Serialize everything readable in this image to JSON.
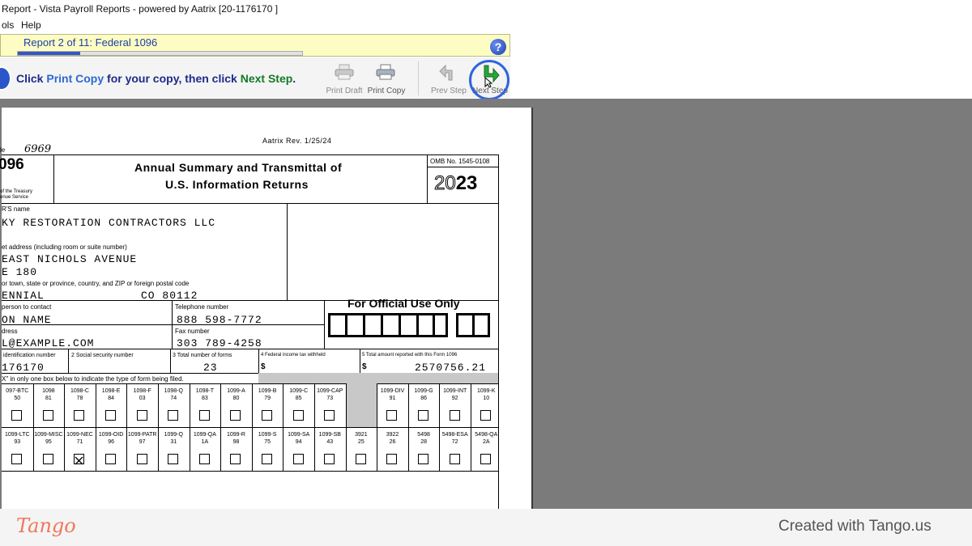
{
  "window": {
    "title": "Report - Vista Payroll Reports - powered by Aatrix [20-1176170 ]"
  },
  "menu": {
    "items": [
      "ols",
      "Help"
    ]
  },
  "report": {
    "title": "Report 2 of 11: Federal 1096",
    "progress": 0.22
  },
  "toolbar": {
    "instr_prefix": "Click ",
    "instr_print_copy": "Print Copy",
    "instr_middle": " for your copy, then click ",
    "instr_next_step": "Next Step",
    "instr_suffix": ".",
    "print_draft": "Print Draft",
    "print_copy": "Print Copy",
    "prev_step": "Prev Step",
    "next_step": "Next Step"
  },
  "form": {
    "rev": "Aatrix Rev. 1/25/24",
    "code_label": "le",
    "code_value": "6969",
    "form_number": "096",
    "dept_line1": "of the Treasury",
    "dept_line2": "enue Service",
    "title1": "Annual Summary and Transmittal of",
    "title2": "U.S. Information Returns",
    "omb": "OMB No. 1545-0108",
    "year_light": "20",
    "year_bold": "23",
    "filer_name_label": "R'S name",
    "filer_name": "KY RESTORATION CONTRACTORS LLC",
    "street_label": "et address (including room or suite number)",
    "street1": " EAST NICHOLS AVENUE",
    "street2": "E 180",
    "city_label": "or town, state or province, country, and ZIP or foreign postal code",
    "city": "ENNIAL",
    "state_zip": "CO 80112",
    "contact_label": "person to contact",
    "contact": "ON NAME",
    "phone_label": "Telephone number",
    "phone": "888 598-7772",
    "email_label": "dress",
    "email": "L@EXAMPLE.COM",
    "fax_label": "Fax number",
    "fax": "303 789-4258",
    "official_use": "For Official Use Only",
    "box1_label": "identification number",
    "box1_value": "176170",
    "box2_label": "2  Social security number",
    "box3_label": "3 Total number of forms",
    "box3_value": "23",
    "box4_label": "4   Federal income tax withheld",
    "box4_value": "$",
    "box5_label": "5  Total amount reported with this Form 1096",
    "box5_dollar": "$",
    "box5_value": "2570756.21",
    "box6_label": "X\" in only one box below to indicate the type of form being filed.",
    "row1": [
      {
        "name": "097-BTC",
        "code": "50",
        "checked": false
      },
      {
        "name": "1098",
        "code": "81",
        "checked": false
      },
      {
        "name": "1098-C",
        "code": "78",
        "checked": false
      },
      {
        "name": "1098-E",
        "code": "84",
        "checked": false
      },
      {
        "name": "1098-F",
        "code": "03",
        "checked": false
      },
      {
        "name": "1098-Q",
        "code": "74",
        "checked": false
      },
      {
        "name": "1098-T",
        "code": "83",
        "checked": false
      },
      {
        "name": "1099-A",
        "code": "80",
        "checked": false
      },
      {
        "name": "1099-B",
        "code": "79",
        "checked": false
      },
      {
        "name": "1099-C",
        "code": "85",
        "checked": false
      },
      {
        "name": "1099-CAP",
        "code": "73",
        "checked": false
      },
      {
        "name": "",
        "code": "",
        "checked": false
      },
      {
        "name": "1099-DIV",
        "code": "91",
        "checked": false
      },
      {
        "name": "1099-G",
        "code": "86",
        "checked": false
      },
      {
        "name": "1099-INT",
        "code": "92",
        "checked": false
      },
      {
        "name": "1099-K",
        "code": "10",
        "checked": false
      }
    ],
    "row2": [
      {
        "name": "1099-LTC",
        "code": "93",
        "checked": false
      },
      {
        "name": "1099-MISC",
        "code": "95",
        "checked": false
      },
      {
        "name": "1099-NEC",
        "code": "71",
        "checked": true
      },
      {
        "name": "1099-OID",
        "code": "96",
        "checked": false
      },
      {
        "name": "1099-PATR",
        "code": "97",
        "checked": false
      },
      {
        "name": "1099-Q",
        "code": "31",
        "checked": false
      },
      {
        "name": "1099-QA",
        "code": "1A",
        "checked": false
      },
      {
        "name": "1099-R",
        "code": "98",
        "checked": false
      },
      {
        "name": "1099-S",
        "code": "75",
        "checked": false
      },
      {
        "name": "1099-SA",
        "code": "94",
        "checked": false
      },
      {
        "name": "1099-SB",
        "code": "43",
        "checked": false
      },
      {
        "name": "3921",
        "code": "25",
        "checked": false
      },
      {
        "name": "3922",
        "code": "26",
        "checked": false
      },
      {
        "name": "5498",
        "code": "28",
        "checked": false
      },
      {
        "name": "5498-ESA",
        "code": "72",
        "checked": false
      },
      {
        "name": "5498-QA",
        "code": "2A",
        "checked": false
      }
    ]
  },
  "footer": {
    "logo": "Tango",
    "created": "Created with Tango.us"
  }
}
